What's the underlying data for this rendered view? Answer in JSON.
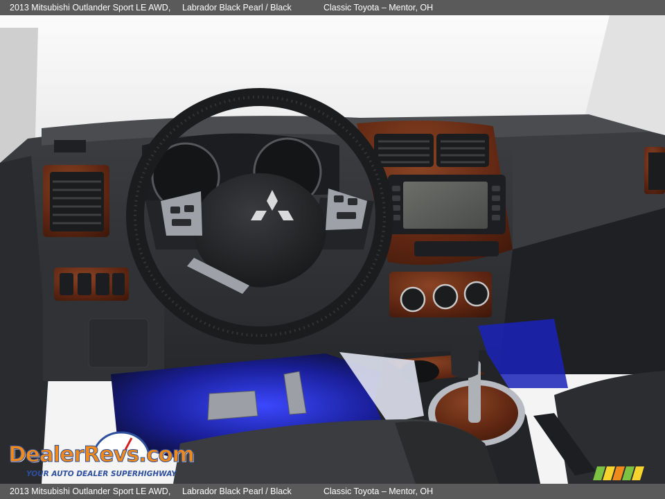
{
  "header": {
    "title": "2013 Mitsubishi Outlander Sport LE AWD,",
    "color": "Labrador Black Pearl / Black",
    "dealer": "Classic Toyota – Mentor, OH"
  },
  "footer": {
    "title": "2013 Mitsubishi Outlander Sport LE AWD,",
    "color": "Labrador Black Pearl / Black",
    "dealer": "Classic Toyota – Mentor, OH"
  },
  "watermark": {
    "brand": "DealerRevs.com",
    "tagline": "YOUR AUTO DEALER SUPERHIGHWAY"
  },
  "colors": {
    "bar_bg": "#5a5a5a",
    "bar_text": "#ffffff",
    "dashboard": "#2e3034",
    "wood_trim": "#6b2e18",
    "footwell_light": "#2f3cff",
    "brand_orange": "#f08a1c",
    "brand_blue": "#2c4f9e"
  }
}
